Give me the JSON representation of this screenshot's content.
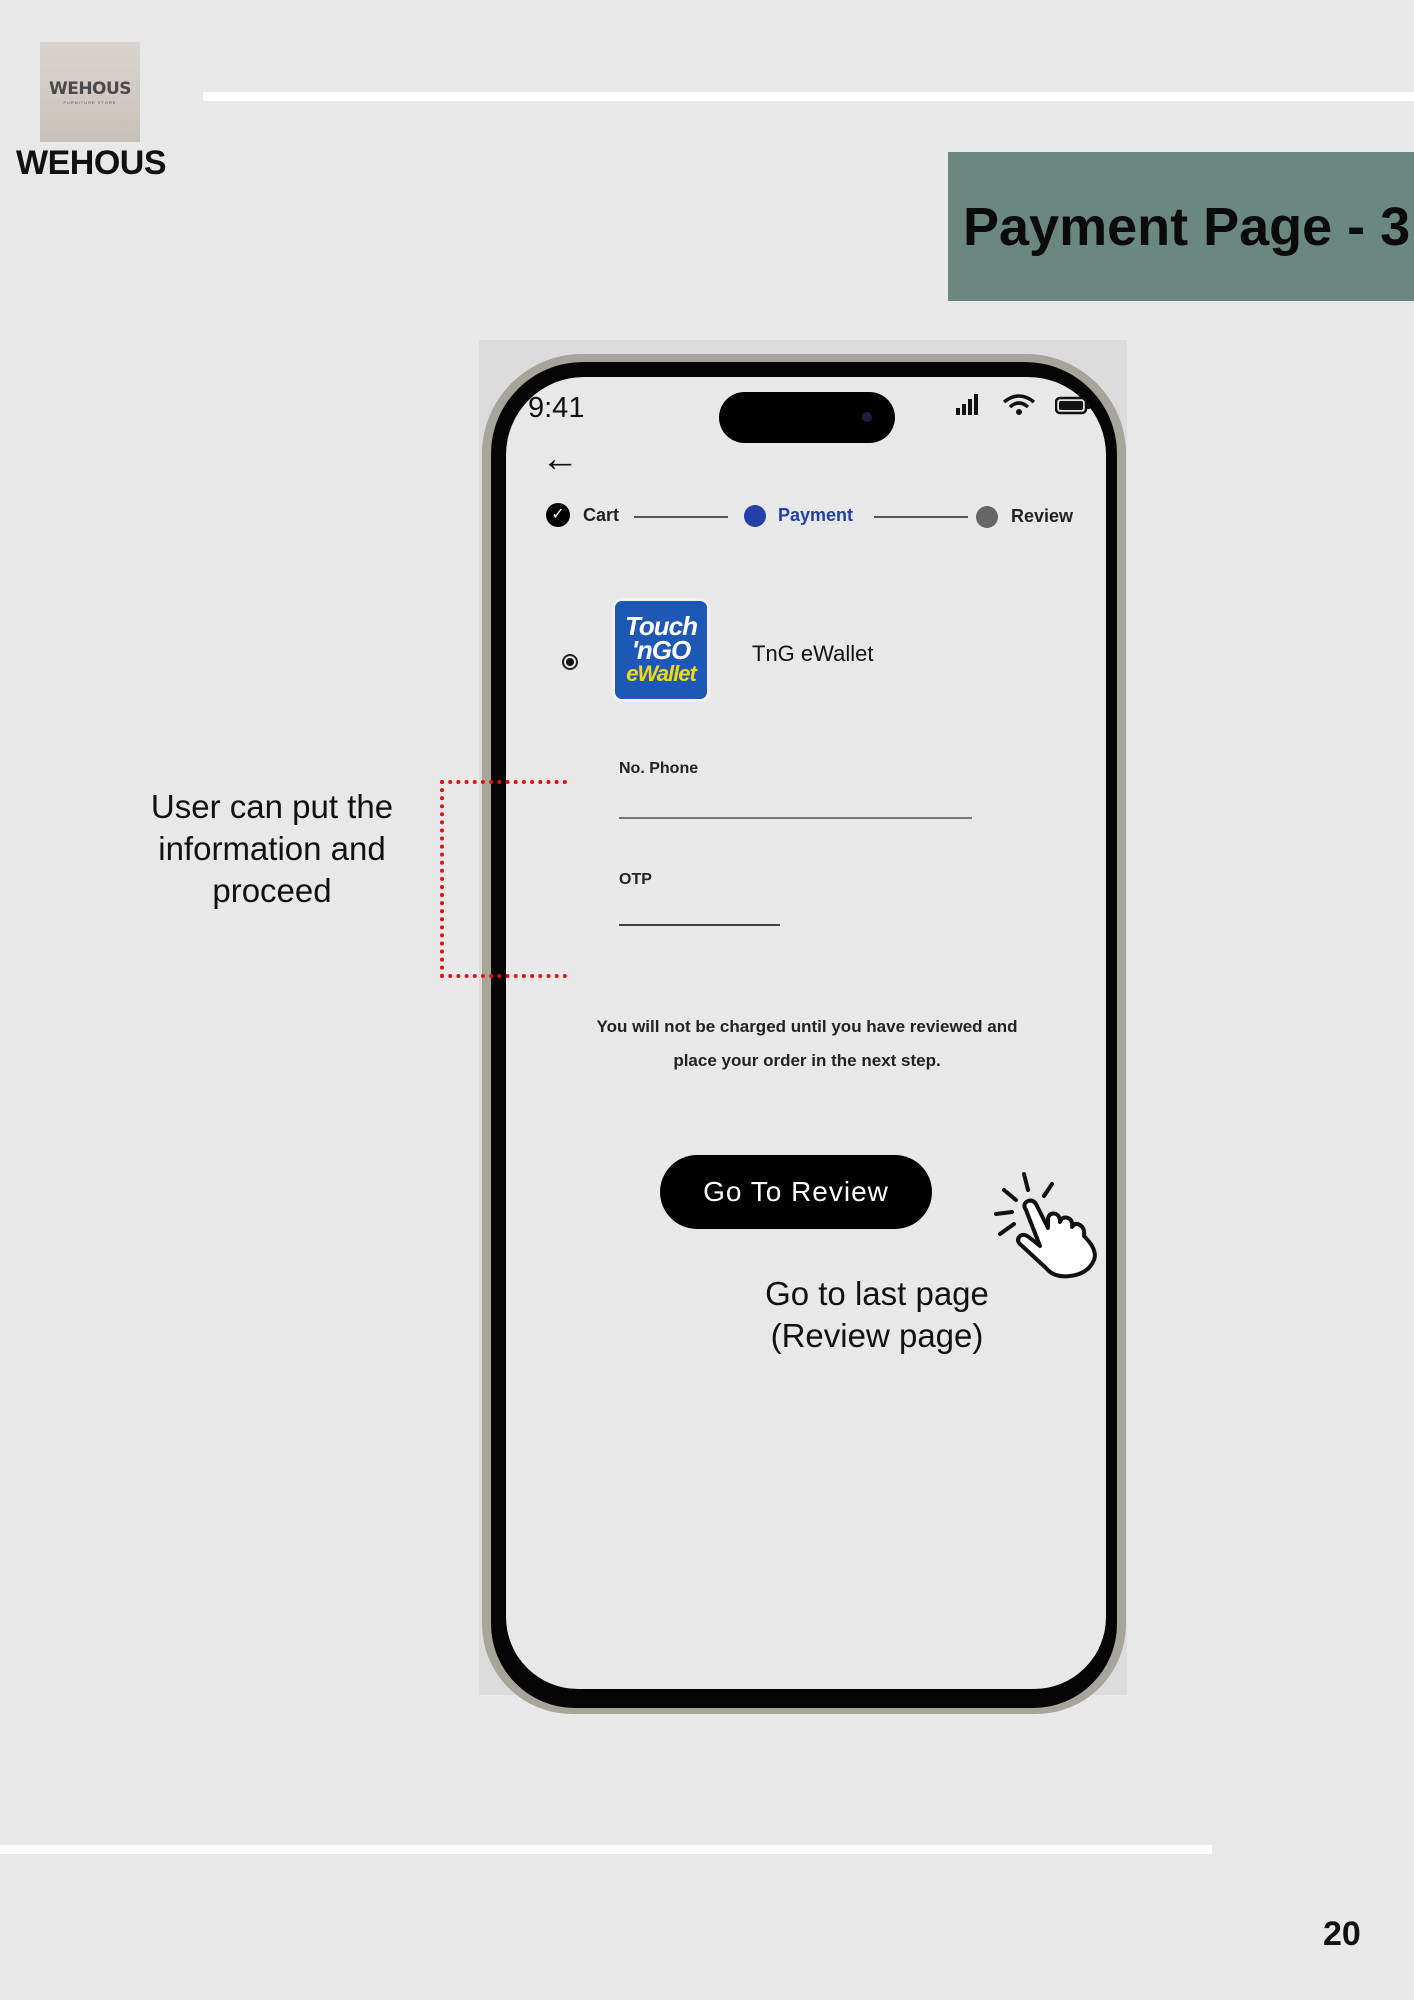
{
  "brand": {
    "logo_text": "WEHOUS",
    "logo_subtext": "FURNITURE STORE",
    "name": "WEHOUS"
  },
  "page": {
    "title": "Payment Page - 3",
    "number": "20"
  },
  "phone": {
    "status_bar": {
      "time": "9:41"
    },
    "stepper": {
      "steps": [
        {
          "label": "Cart",
          "state": "complete"
        },
        {
          "label": "Payment",
          "state": "active"
        },
        {
          "label": "Review",
          "state": "upcoming"
        }
      ]
    },
    "payment_method": {
      "label": "TnG eWallet",
      "selected": true,
      "logo_lines": [
        "Touch",
        "'nGO",
        "eWallet"
      ]
    },
    "fields": {
      "phone_label": "No. Phone",
      "otp_label": "OTP"
    },
    "note": "You will not be charged until you have reviewed and place your order in the next step.",
    "primary_button": "Go To Review"
  },
  "annotations": {
    "left": "User can put the information and proceed",
    "right": "Go to last page (Review page)"
  },
  "colors": {
    "background": "#e8e8e8",
    "title_box": "#6a8780",
    "active_step": "#2140a8",
    "highlight": "#e01010",
    "tng_blue": "#1d58b6",
    "tng_yellow": "#f5d90a"
  }
}
